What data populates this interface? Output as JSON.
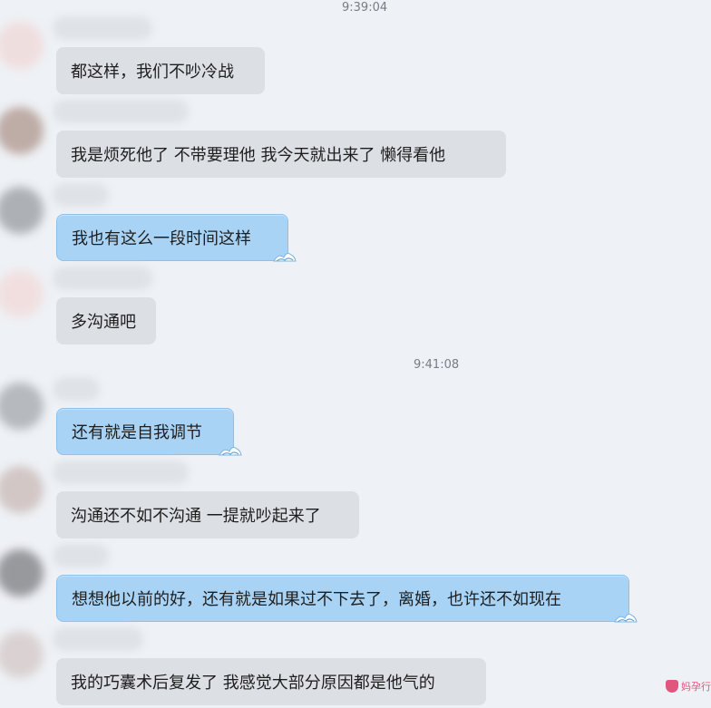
{
  "chat": {
    "timestamp_1": "9:39:04",
    "timestamp_2": "9:41:08",
    "messages": [
      {
        "text": "都这样，我们不吵冷战",
        "style": "gray"
      },
      {
        "text": "我是烦死他了 不带要理他 我今天就出来了 懒得看他",
        "style": "gray"
      },
      {
        "text": "我也有这么一段时间这样",
        "style": "blue"
      },
      {
        "text": "多沟通吧",
        "style": "gray"
      },
      {
        "text": "还有就是自我调节",
        "style": "blue"
      },
      {
        "text": "沟通还不如不沟通 一提就吵起来了",
        "style": "gray"
      },
      {
        "text": "想想他以前的好，还有就是如果过不下去了，离婚，也许还不如现在",
        "style": "blue"
      },
      {
        "text": "我的巧囊术后复发了 我感觉大部分原因都是他气的",
        "style": "gray"
      }
    ]
  },
  "watermark": {
    "text": "妈孕行"
  },
  "colors": {
    "background": "#eef1f5",
    "gray_bubble": "#dcdfe3",
    "blue_bubble": "#a9d3f5",
    "blue_border": "#8cc0ea",
    "timestamp": "#777d86",
    "watermark": "#e2557d"
  },
  "icons": [
    "blurred-avatar-icon",
    "bubble-wave-icon",
    "watermark-logo-icon"
  ]
}
